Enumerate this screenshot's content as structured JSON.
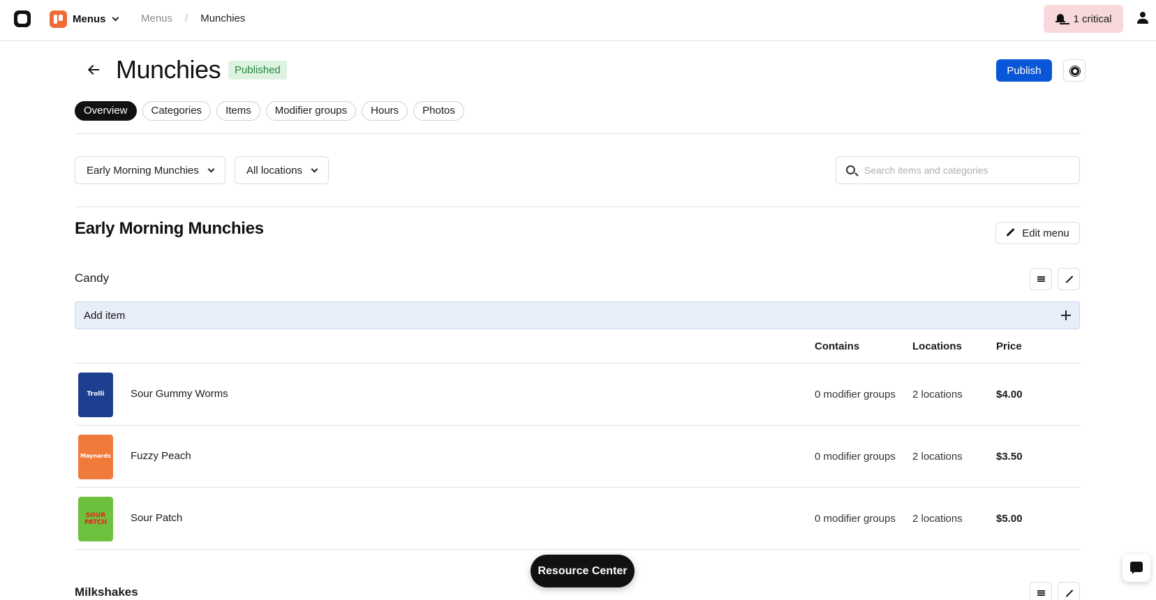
{
  "topbar": {
    "app_name": "Menus",
    "breadcrumb": {
      "parent": "Menus",
      "separator": "/",
      "current": "Munchies"
    },
    "alerts_label": "1 critical"
  },
  "header": {
    "title": "Munchies",
    "status": "Published",
    "publish_label": "Publish"
  },
  "tabs": [
    {
      "label": "Overview",
      "active": true
    },
    {
      "label": "Categories",
      "active": false
    },
    {
      "label": "Items",
      "active": false
    },
    {
      "label": "Modifier groups",
      "active": false
    },
    {
      "label": "Hours",
      "active": false
    },
    {
      "label": "Photos",
      "active": false
    }
  ],
  "filters": {
    "menu_select": "Early Morning Munchies",
    "location_select": "All locations",
    "search_placeholder": "Search items and categories"
  },
  "menu": {
    "title": "Early Morning Munchies",
    "edit_label": "Edit menu",
    "categories": [
      {
        "name": "Candy",
        "add_item_label": "Add item",
        "columns": {
          "contains": "Contains",
          "locations": "Locations",
          "price": "Price"
        },
        "items": [
          {
            "name": "Sour Gummy Worms",
            "contains": "0 modifier groups",
            "locations": "2 locations",
            "price": "$4.00",
            "thumb_label": "Trolli",
            "thumb_color": "#1d3f8f"
          },
          {
            "name": "Fuzzy Peach",
            "contains": "0 modifier groups",
            "locations": "2 locations",
            "price": "$3.50",
            "thumb_label": "Maynards",
            "thumb_color": "#f07a3a"
          },
          {
            "name": "Sour Patch",
            "contains": "0 modifier groups",
            "locations": "2 locations",
            "price": "$5.00",
            "thumb_label": "SOUR PATCH",
            "thumb_color": "#6dc13c"
          }
        ]
      },
      {
        "name": "Milkshakes"
      }
    ]
  },
  "resource_center_label": "Resource Center",
  "colors": {
    "primary": "#0a56d8",
    "published_bg": "#def2e1",
    "published_text": "#238a3b",
    "critical_bg": "#f8d8da",
    "add_item_bg": "#e8eef9"
  }
}
